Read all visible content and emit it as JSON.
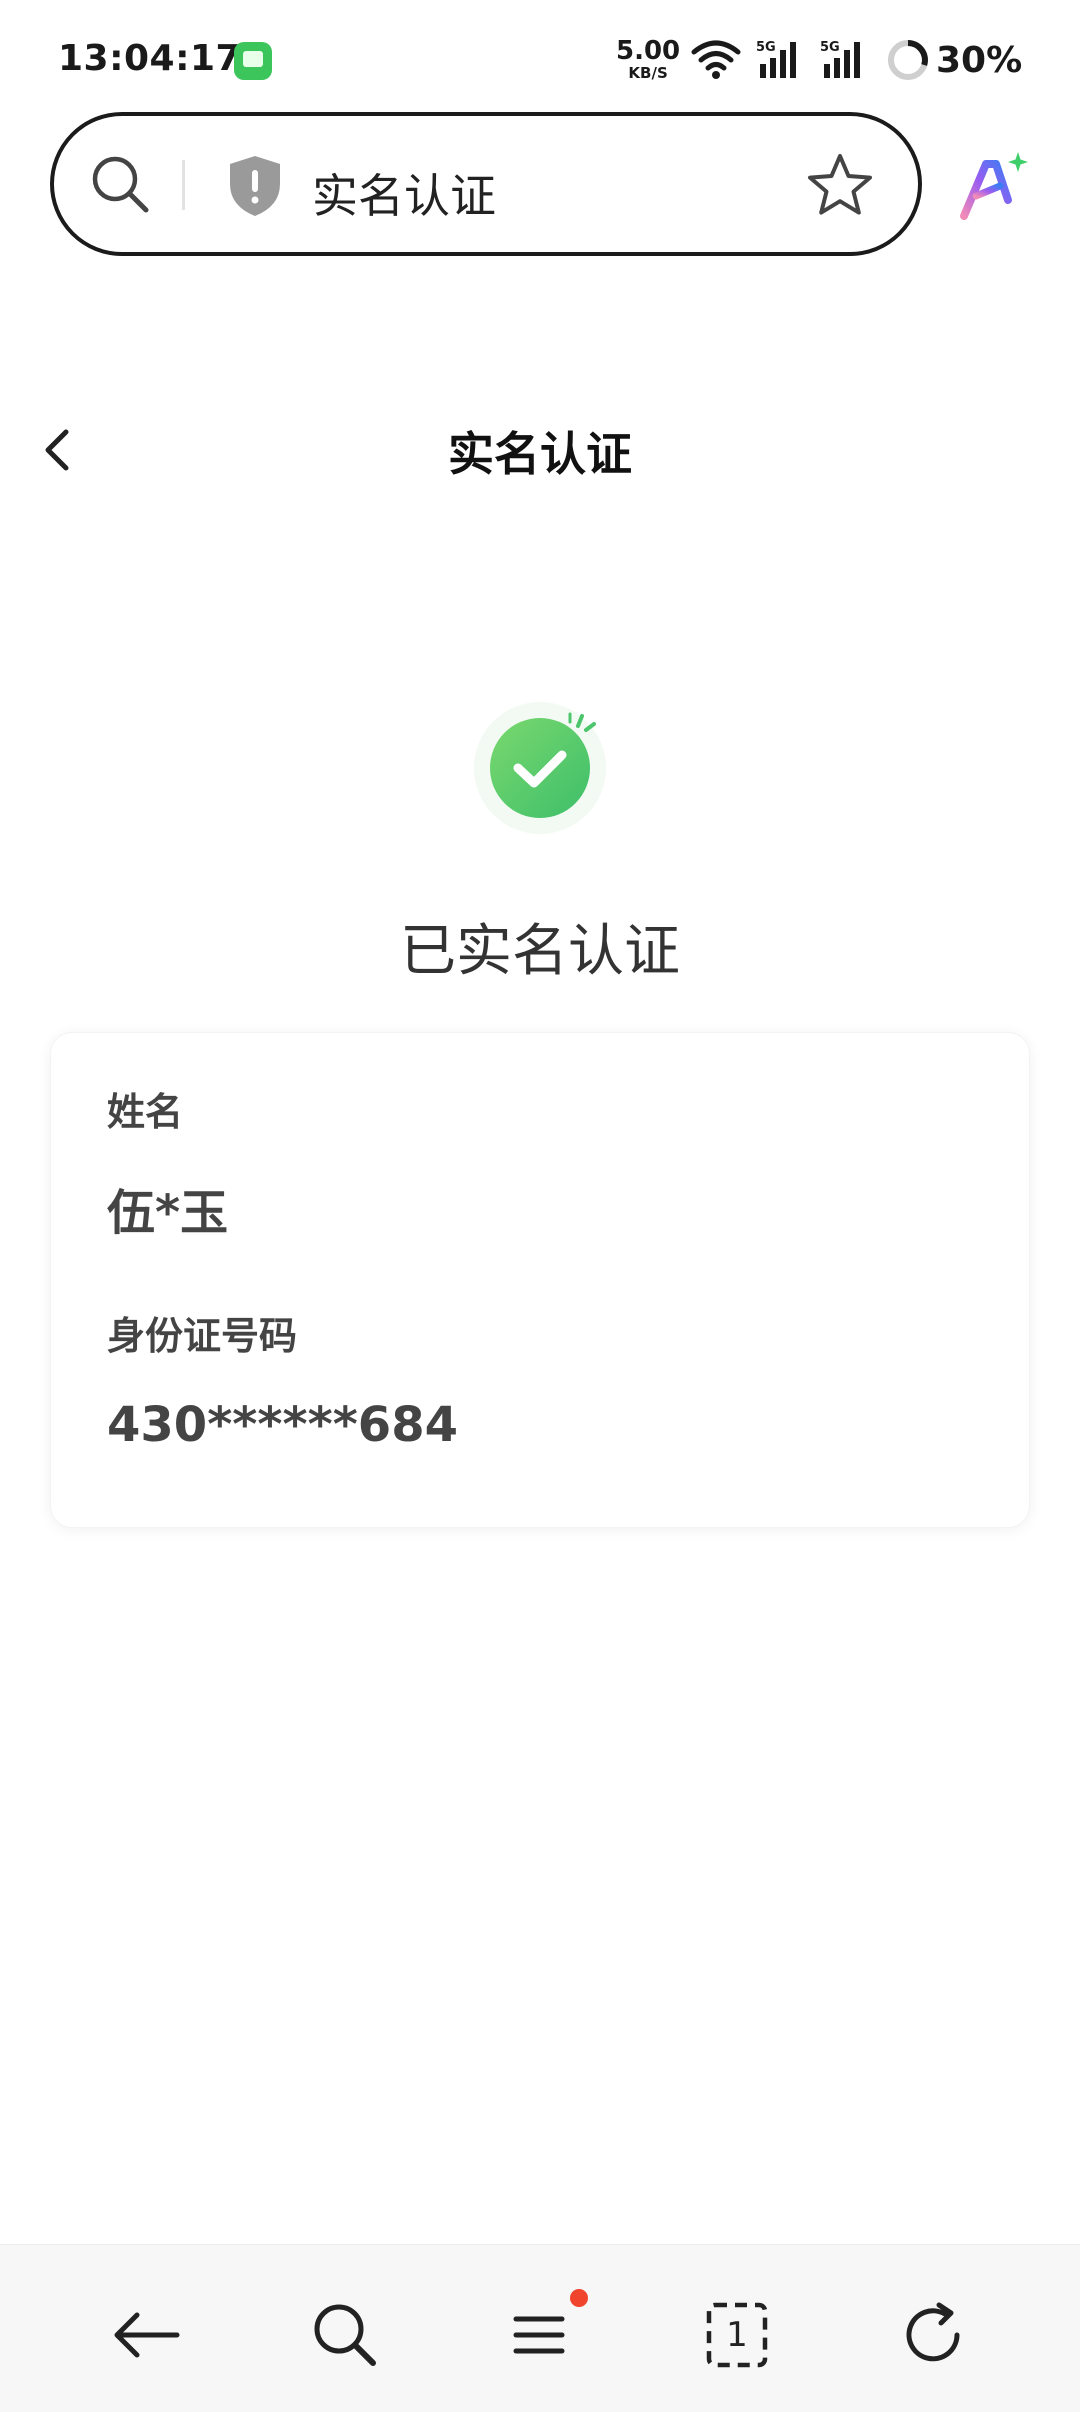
{
  "status_bar": {
    "time": "13:04:17",
    "net_speed_value": "5.00",
    "net_speed_unit": "KB/S",
    "signal1_label": "5G",
    "signal2_label": "5G",
    "battery": "30%",
    "icons": [
      "message-app-icon",
      "wifi-icon",
      "signal-icon",
      "battery-ring-icon"
    ]
  },
  "address_bar": {
    "title": "实名认证",
    "icons": [
      "search-icon",
      "shield-icon",
      "star-icon",
      "ai-assistant-icon"
    ]
  },
  "header": {
    "title": "实名认证",
    "back_icon": "chevron-left-icon"
  },
  "status": {
    "text": "已实名认证",
    "icon": "check-circle-icon",
    "color": "#4cc56c"
  },
  "info_card": {
    "name_label": "姓名",
    "name_value": "伍*玉",
    "id_label": "身份证号码",
    "id_value": "430******684"
  },
  "bottom_nav": {
    "tab_count": "1",
    "icons": [
      "back-arrow-icon",
      "search-icon",
      "menu-icon",
      "tabs-icon",
      "refresh-icon"
    ],
    "badge_color": "#f0442c"
  }
}
